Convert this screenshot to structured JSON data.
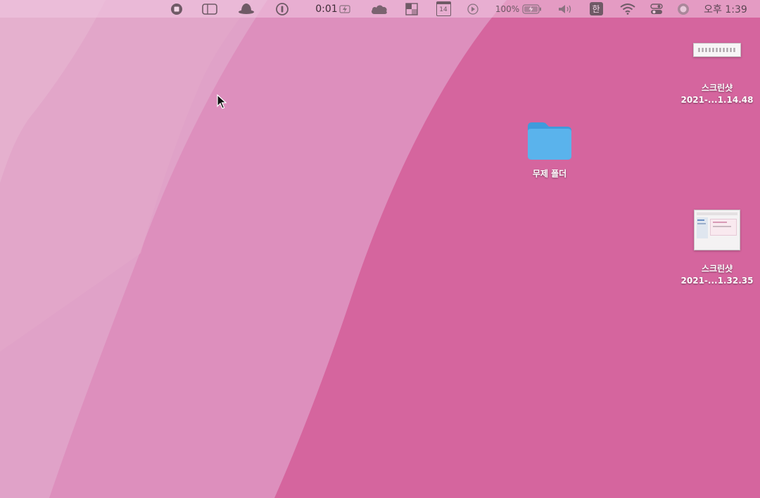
{
  "menubar": {
    "items": [
      {
        "icon": "record-stop-icon"
      },
      {
        "icon": "window-switcher-icon"
      },
      {
        "icon": "hat-icon"
      },
      {
        "icon": "password-manager-icon"
      },
      {
        "timer": "0:01",
        "icon": "battery-charging-bolt-icon"
      },
      {
        "icon": "cloud-icon"
      },
      {
        "icon": "tiles-icon"
      },
      {
        "icon": "calendar-icon",
        "calendar_day": "14"
      },
      {
        "icon": "play-icon"
      },
      {
        "battery_percent": "100%",
        "icon": "battery-icon"
      },
      {
        "icon": "volume-icon"
      },
      {
        "icon": "korean-input-icon",
        "input_label": "한"
      },
      {
        "icon": "wifi-icon"
      },
      {
        "icon": "control-center-icon"
      },
      {
        "icon": "siri-icon"
      }
    ],
    "clock": "오후 1:39"
  },
  "desktop": {
    "screenshot1": {
      "name_line1": "스크린샷",
      "name_line2": "2021-...1.14.48"
    },
    "folder": {
      "name": "무제 폴더",
      "color": "#5ab3ec"
    },
    "screenshot2": {
      "name_line1": "스크린샷",
      "name_line2": "2021-...1.32.35"
    }
  },
  "colors": {
    "wallpaper_light": "#e6b1d0",
    "wallpaper_mid": "#de9dc4",
    "wallpaper_dark": "#d5659e"
  }
}
